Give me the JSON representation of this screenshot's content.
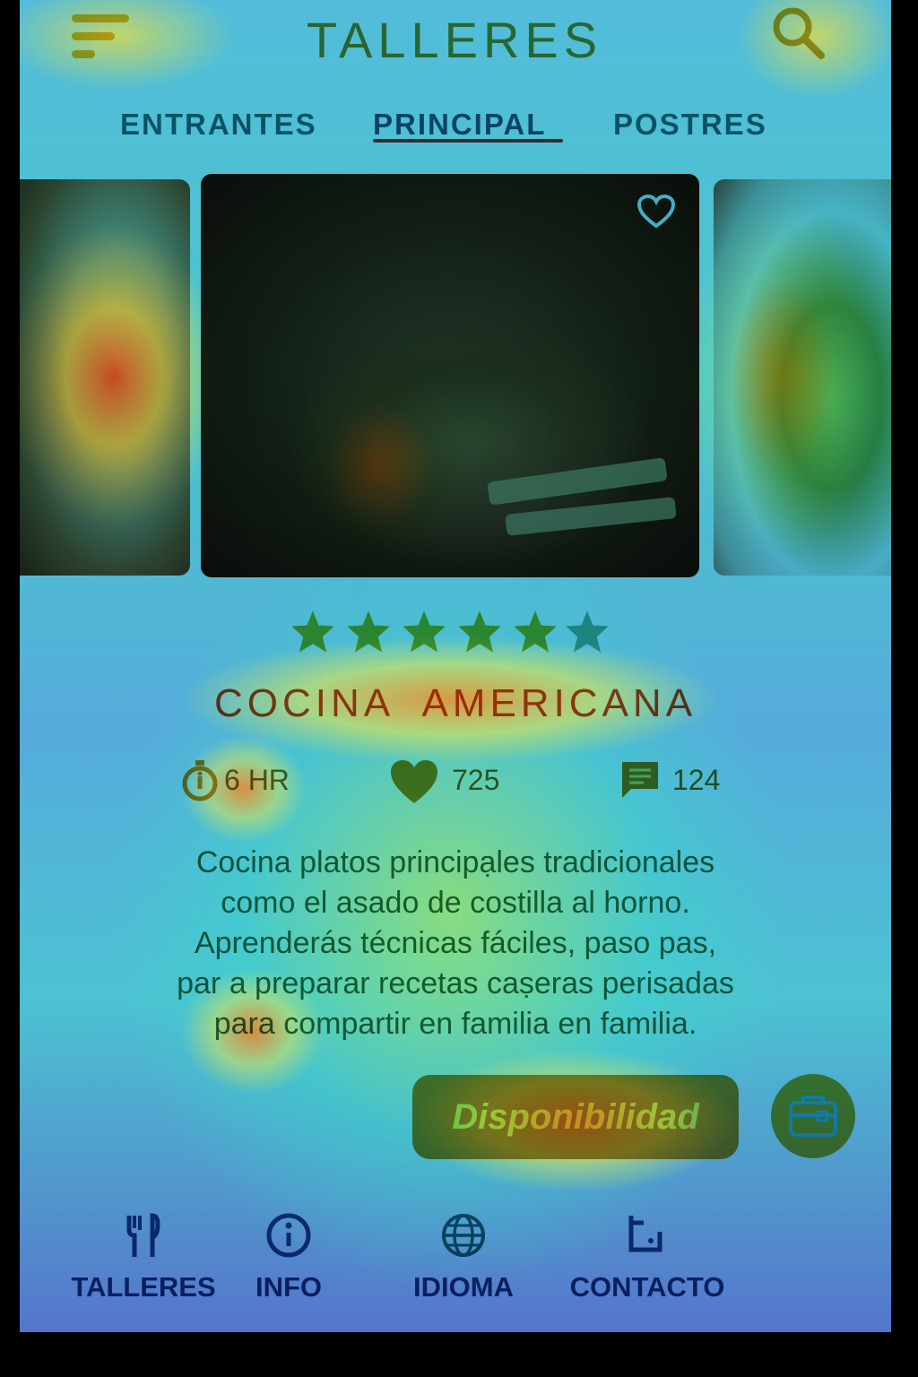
{
  "header": {
    "title": "TALLERES",
    "menu_icon": "menu-icon",
    "search_icon": "search-icon"
  },
  "tabs": [
    {
      "label": "ENTRANTES",
      "active": false
    },
    {
      "label": "PRINCIPAL",
      "active": true
    },
    {
      "label": "POSTRES",
      "active": false
    }
  ],
  "carousel": {
    "items": [
      "left-dish-image",
      "roast-rib-image",
      "right-dish-image"
    ],
    "favorite_icon": "heart-outline-icon"
  },
  "course": {
    "rating": 5,
    "rating_max": 6,
    "title": "COCINA  AMERICANA",
    "stats": {
      "duration": "6 HR",
      "likes": "725",
      "comments": "124"
    },
    "description_lines": [
      "Cocina platos principạles tradicionales",
      "como el asado de costilla al horno.",
      "Aprenderás técnicas fáciles, paso pas,",
      "par a preparar recetas caṣeras perisadas",
      "para compartir en familia en familia."
    ]
  },
  "actions": {
    "availability_label": "Disponibilidad",
    "cart_icon": "briefcase-icon"
  },
  "bottom_nav": [
    {
      "label": "TALLERES",
      "icon": "utensils-icon"
    },
    {
      "label": "INFO",
      "icon": "info-icon"
    },
    {
      "label": "IDIOMA",
      "icon": "globe-icon"
    },
    {
      "label": "CONTACTO",
      "icon": "contact-icon"
    }
  ],
  "colors": {
    "accent_title": "#c2451e",
    "tab_underline": "#b23c3c",
    "button_bg": "#b98a35",
    "nav_text": "#1d3e78"
  }
}
